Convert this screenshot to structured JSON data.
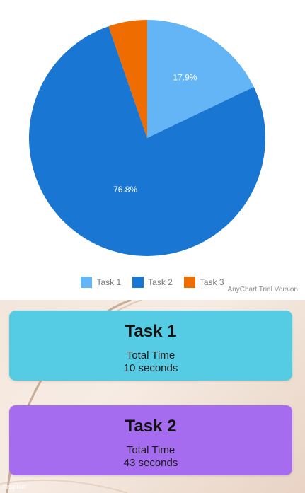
{
  "chart_data": {
    "type": "pie",
    "categories": [
      "Task 1",
      "Task 2",
      "Task 3"
    ],
    "values": [
      17.9,
      76.8,
      5.3
    ],
    "colors": [
      "#64b5f6",
      "#1976d2",
      "#ef6c00"
    ],
    "data_labels": [
      "17.9%",
      "76.8%",
      ""
    ],
    "legend_position": "bottom"
  },
  "legend": {
    "items": [
      {
        "label": "Task 1",
        "color": "#64b5f6"
      },
      {
        "label": "Task 2",
        "color": "#1976d2"
      },
      {
        "label": "Task 3",
        "color": "#ef6c00"
      }
    ]
  },
  "watermark": "AnyChart Trial Version",
  "cards": [
    {
      "title": "Task 1",
      "label": "Total Time",
      "value": "10 seconds",
      "color": "#55cce3"
    },
    {
      "title": "Task 2",
      "label": "Total Time",
      "value": "43 seconds",
      "color": "#a66cf0"
    }
  ],
  "brand": "rawpixel"
}
